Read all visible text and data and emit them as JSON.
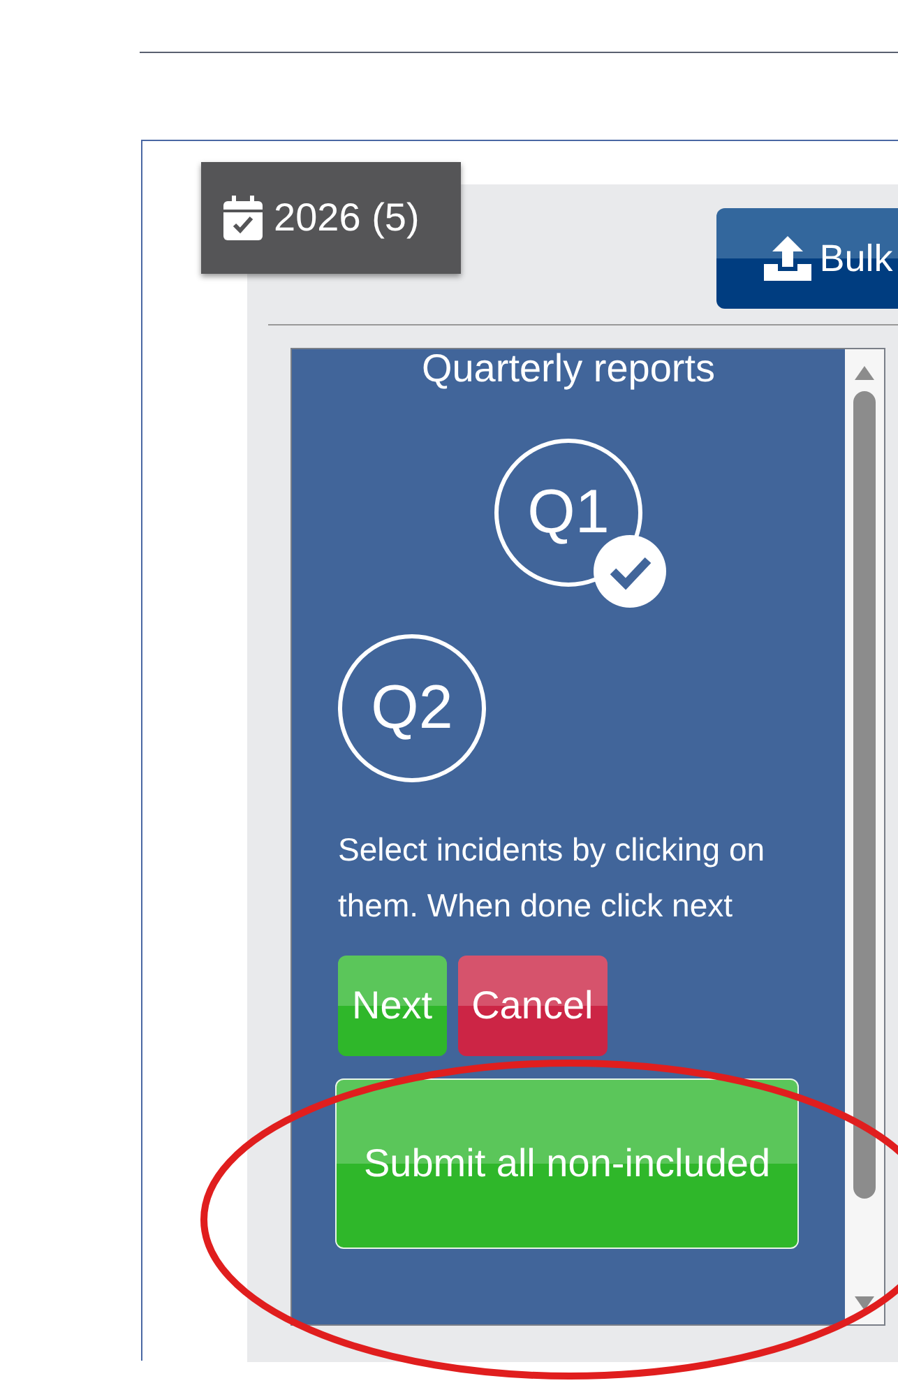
{
  "year_badge": {
    "label": "2026 (5)"
  },
  "bulk_button": {
    "label": "Bulk"
  },
  "panel": {
    "title": "Quarterly reports",
    "quarters": [
      {
        "label": "Q1",
        "checked": true
      },
      {
        "label": "Q2",
        "checked": false
      }
    ],
    "instructions": "Select incidents by clicking on them. When done click next",
    "buttons": [
      {
        "label": "Next",
        "kind": "success"
      },
      {
        "label": "Cancel",
        "kind": "danger"
      }
    ],
    "submit_button": {
      "label": "Submit all non-included"
    }
  }
}
